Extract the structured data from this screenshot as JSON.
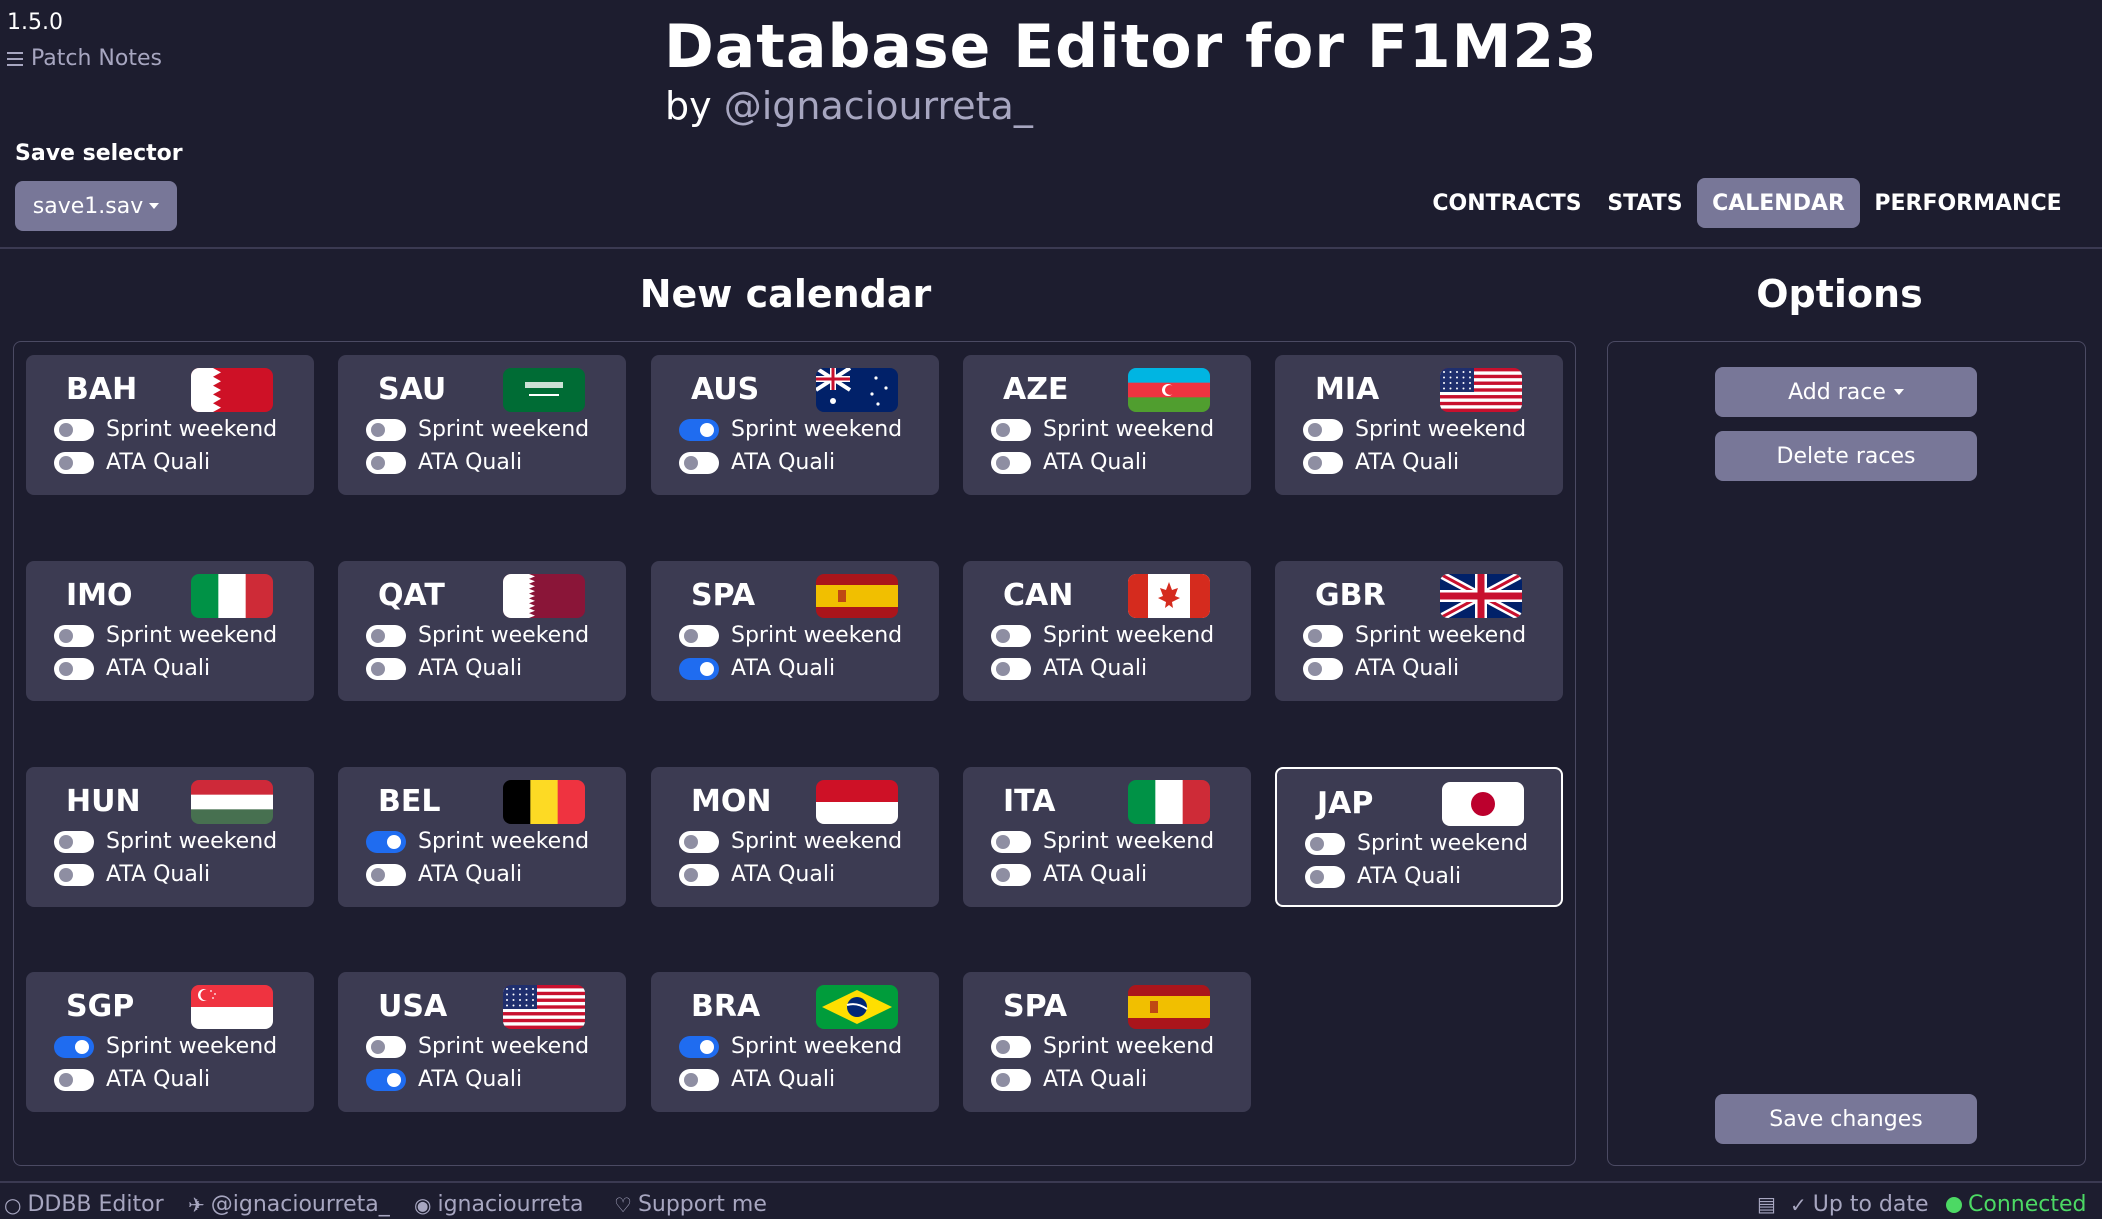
{
  "header": {
    "version": "1.5.0",
    "patch_notes": "Patch Notes",
    "title": "Database Editor for F1M23",
    "by": "by ",
    "author": "@ignaciourreta_"
  },
  "save": {
    "label": "Save selector",
    "value": "save1.sav"
  },
  "nav": [
    "CONTRACTS",
    "STATS",
    "CALENDAR",
    "PERFORMANCE"
  ],
  "nav_active": "CALENDAR",
  "calendar": {
    "title": "New calendar",
    "sprint_label": "Sprint weekend",
    "quali_label": "ATA Quali",
    "races": [
      {
        "code": "BAH",
        "flag": "bahrain",
        "sprint": false,
        "ata": false
      },
      {
        "code": "SAU",
        "flag": "saudi-arabia",
        "sprint": false,
        "ata": false
      },
      {
        "code": "AUS",
        "flag": "australia",
        "sprint": true,
        "ata": false
      },
      {
        "code": "AZE",
        "flag": "azerbaijan",
        "sprint": false,
        "ata": false
      },
      {
        "code": "MIA",
        "flag": "usa",
        "sprint": false,
        "ata": false
      },
      {
        "code": "IMO",
        "flag": "italy",
        "sprint": false,
        "ata": false
      },
      {
        "code": "QAT",
        "flag": "qatar",
        "sprint": false,
        "ata": false
      },
      {
        "code": "SPA",
        "flag": "spain",
        "sprint": false,
        "ata": true
      },
      {
        "code": "CAN",
        "flag": "canada",
        "sprint": false,
        "ata": false
      },
      {
        "code": "GBR",
        "flag": "uk",
        "sprint": false,
        "ata": false
      },
      {
        "code": "HUN",
        "flag": "hungary",
        "sprint": false,
        "ata": false
      },
      {
        "code": "BEL",
        "flag": "belgium",
        "sprint": true,
        "ata": false
      },
      {
        "code": "MON",
        "flag": "monaco",
        "sprint": false,
        "ata": false
      },
      {
        "code": "ITA",
        "flag": "italy",
        "sprint": false,
        "ata": false
      },
      {
        "code": "JAP",
        "flag": "japan",
        "sprint": false,
        "ata": false,
        "selected": true
      },
      {
        "code": "SGP",
        "flag": "singapore",
        "sprint": true,
        "ata": false
      },
      {
        "code": "USA",
        "flag": "usa",
        "sprint": false,
        "ata": true
      },
      {
        "code": "BRA",
        "flag": "brazil",
        "sprint": true,
        "ata": false
      },
      {
        "code": "SPA",
        "flag": "spain",
        "sprint": false,
        "ata": false
      }
    ]
  },
  "options": {
    "title": "Options",
    "add_race": "Add race",
    "delete_races": "Delete races",
    "save_changes": "Save changes"
  },
  "footer": {
    "repo": "DDBB Editor",
    "twitter": "@ignaciourreta_",
    "github": "ignaciourreta",
    "support": "Support me",
    "status": "Up to date",
    "connection": "Connected"
  },
  "colors": {
    "background": "#1d1d2f",
    "card": "#3c3b52",
    "accent": "#787798",
    "toggle_on": "#1f6cf0",
    "connected": "#4cd964"
  }
}
